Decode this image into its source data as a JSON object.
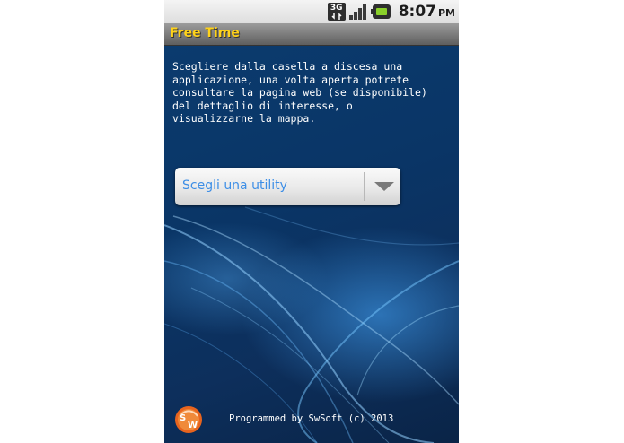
{
  "status_bar": {
    "network_label": "3G",
    "time": "8:07",
    "time_suffix": "PM",
    "icons": [
      "3g-network-icon",
      "signal-strength-icon",
      "battery-icon"
    ]
  },
  "app": {
    "title": "Free Time",
    "title_color": "#ffd21a"
  },
  "main": {
    "intro_text": "Scegliere dalla casella a discesa una\napplicazione, una volta aperta potrete\nconsultare la pagina web (se disponibile)\ndel dettaglio di interesse, o\nvisualizzarne la mappa.",
    "spinner_placeholder": "Scegli una utility",
    "spinner_text_color": "#3d8ee6"
  },
  "footer": {
    "logo_text": "SW",
    "credit": "Programmed by SwSoft (c) 2013"
  }
}
